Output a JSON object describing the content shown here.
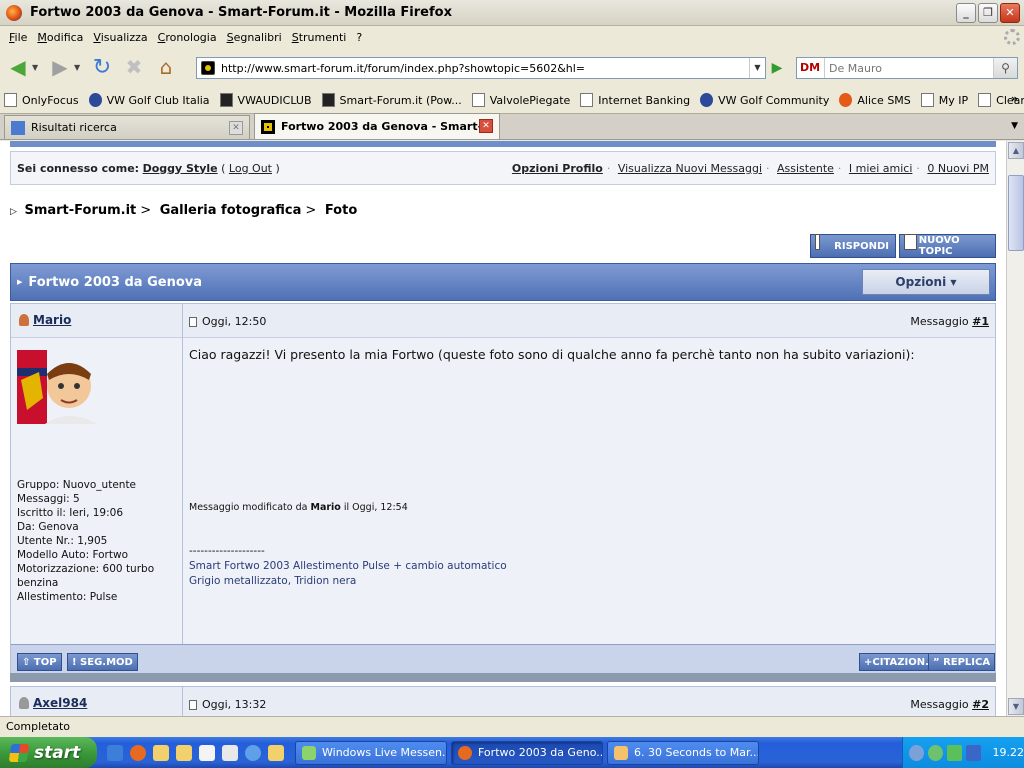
{
  "window": {
    "title": "Fortwo 2003 da Genova - Smart-Forum.it - Mozilla Firefox"
  },
  "menu": [
    "File",
    "Modifica",
    "Visualizza",
    "Cronologia",
    "Segnalibri",
    "Strumenti",
    "?"
  ],
  "nav": {
    "url": "http://www.smart-forum.it/forum/index.php?showtopic=5602&hl=",
    "search_engine": "DM",
    "search_placeholder": "De Mauro"
  },
  "bookmarks": [
    "OnlyFocus",
    "VW Golf Club Italia",
    "VWAUDICLUB",
    "Smart-Forum.it (Pow...",
    "ValvolePiegate",
    "Internet Banking",
    "VW Golf Community",
    "Alice SMS",
    "My IP",
    "Cleaned.it - Indice"
  ],
  "tabs": [
    {
      "label": "Risultati ricerca",
      "active": false
    },
    {
      "label": "Fortwo 2003 da Genova - Smart-...",
      "active": true
    }
  ],
  "forum": {
    "userbar": {
      "connected_label": "Sei connesso come:",
      "username": "Doggy Style",
      "logout": "Log Out",
      "links": [
        "Opzioni Profilo",
        "Visualizza Nuovi Messaggi",
        "Assistente",
        "I miei amici",
        "0 Nuovi PM"
      ]
    },
    "breadcrumb": [
      "Smart-Forum.it",
      "Galleria fotografica",
      "Foto"
    ],
    "buttons": {
      "reply": "RISPONDI",
      "new_topic": "NUOVO TOPIC"
    },
    "topic_title": "Fortwo 2003 da Genova",
    "options_label": "Opzioni",
    "post1": {
      "author": "Mario",
      "date": "Oggi, 12:50",
      "number_prefix": "Messaggio",
      "number": "#1",
      "body": "Ciao ragazzi! Vi presento la mia Fortwo (queste foto sono di qualche anno fa perchè tanto non ha subito variazioni):",
      "edited_prefix": "Messaggio modificato da",
      "edited_by": "Mario",
      "edited_suffix": "il Oggi, 12:54",
      "signature_dashes": "--------------------",
      "signature_line1": "Smart Fortwo 2003 Allestimento Pulse + cambio automatico",
      "signature_line2": "Grigio metallizzato, Tridion nera",
      "userinfo": [
        "Gruppo: Nuovo_utente",
        "Messaggi: 5",
        "Iscritto il: Ieri, 19:06",
        "Da: Genova",
        "Utente Nr.: 1,905",
        "Modello Auto: Fortwo",
        "Motorizzazione: 600 turbo benzina",
        "Allestimento: Pulse"
      ],
      "buttons": {
        "top": "TOP",
        "report": "SEG.MOD",
        "quote": "CITAZION.",
        "reply": "REPLICA"
      }
    },
    "post2": {
      "author": "Axel984",
      "date": "Oggi, 13:32",
      "number_prefix": "Messaggio",
      "number": "#2"
    }
  },
  "status": "Completato",
  "taskbar": {
    "start": "start",
    "tasks": [
      "Windows Live Messen...",
      "Fortwo 2003 da Geno...",
      "6. 30 Seconds to Mar..."
    ],
    "clock": "19.22"
  }
}
